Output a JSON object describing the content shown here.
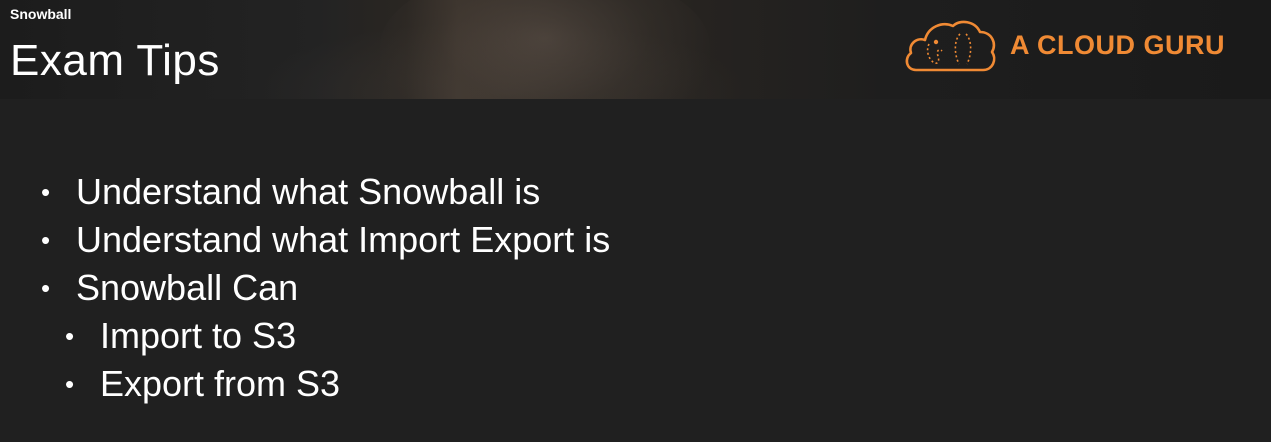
{
  "header": {
    "section_label": "Snowball",
    "title": "Exam Tips"
  },
  "logo": {
    "text": "A CLOUD GURU",
    "icon": "cloud-icon",
    "color": "#f08a34"
  },
  "bullets": [
    {
      "level": 1,
      "text": "Understand what Snowball is"
    },
    {
      "level": 1,
      "text": "Understand what Import Export is"
    },
    {
      "level": 1,
      "text": "Snowball Can"
    },
    {
      "level": 2,
      "text": "Import to S3"
    },
    {
      "level": 2,
      "text": "Export from S3"
    }
  ],
  "bullet_glyph": "•",
  "colors": {
    "background": "#202020",
    "text": "#ffffff",
    "accent": "#f08a34"
  }
}
